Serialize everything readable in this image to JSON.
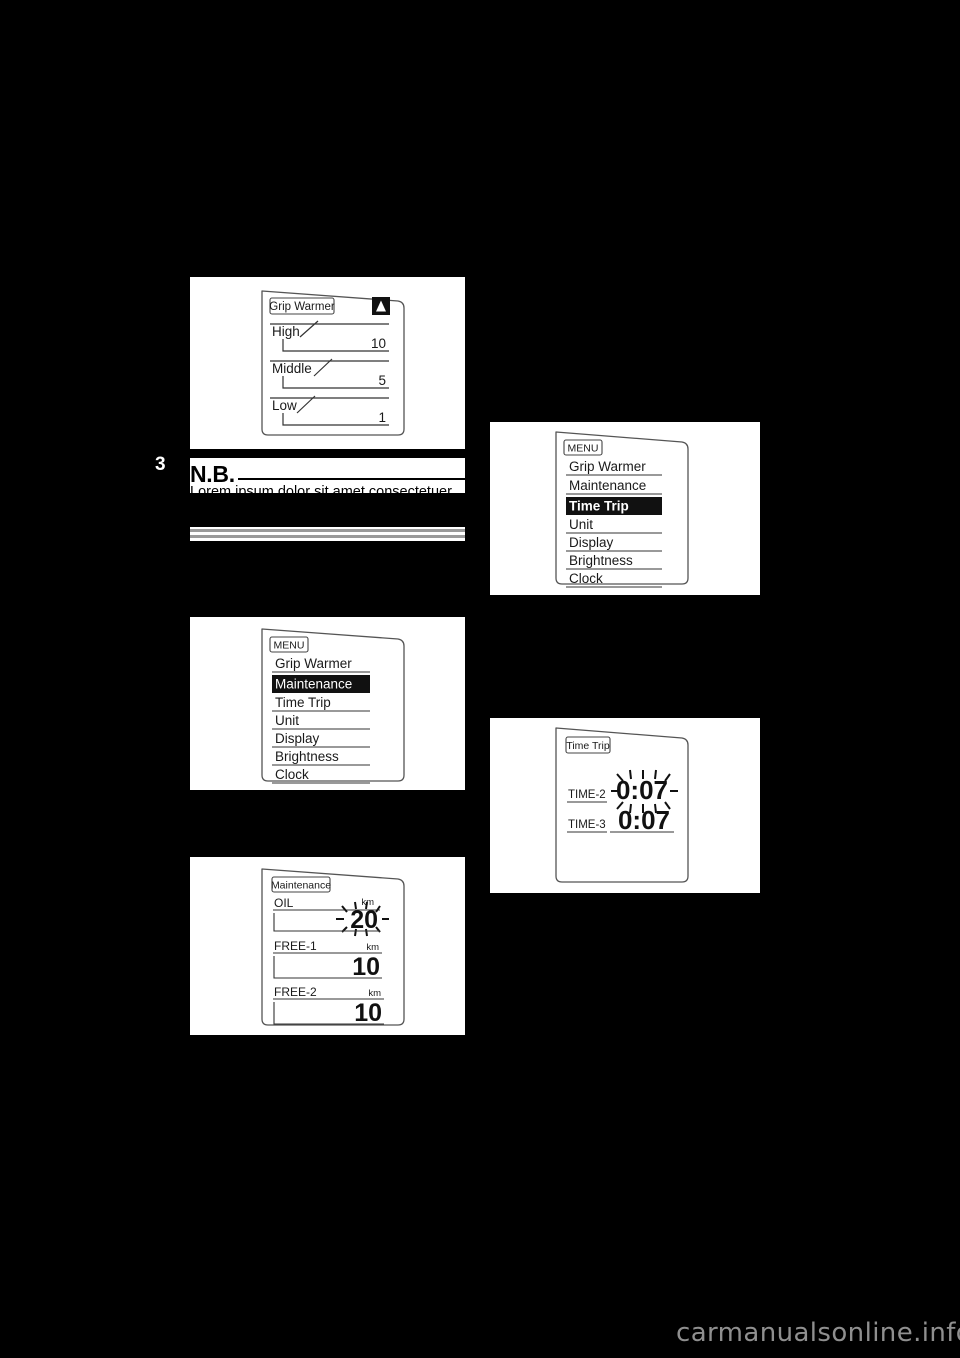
{
  "page": {
    "chapter_tab": "3",
    "background_color": "#000000",
    "panel_color": "#ffffff",
    "watermark": "carmanualsonline.info",
    "watermark_color": "#8f8f8f"
  },
  "note_block": {
    "heading": "N.B.",
    "clipped_line": "Lorem ipsum dolor sit amet consectetuer",
    "rule_color": "#000000",
    "double_rule_color": "#9a9a9a"
  },
  "figures": [
    {
      "id": "grip-warmer-screen",
      "title": "Grip Warmer",
      "indicator_icon": "grip-warmer-flame-icon",
      "rows": [
        {
          "label": "High",
          "value": "10"
        },
        {
          "label": "Middle",
          "value": "5"
        },
        {
          "label": "Low",
          "value": "1"
        }
      ]
    },
    {
      "id": "menu-screen-maintenance",
      "title": "MENU",
      "items": [
        {
          "label": "Grip Warmer",
          "selected": false
        },
        {
          "label": "Maintenance",
          "selected": true
        },
        {
          "label": "Time Trip",
          "selected": false
        },
        {
          "label": "Unit",
          "selected": false
        },
        {
          "label": "Display",
          "selected": false
        },
        {
          "label": "Brightness",
          "selected": false
        },
        {
          "label": "Clock",
          "selected": false
        }
      ]
    },
    {
      "id": "maintenance-screen",
      "title": "Maintenance",
      "rows": [
        {
          "label": "OIL",
          "unit": "km",
          "value": "20",
          "flashing": true
        },
        {
          "label": "FREE-1",
          "unit": "km",
          "value": "10",
          "flashing": false
        },
        {
          "label": "FREE-2",
          "unit": "km",
          "value": "10",
          "flashing": false
        }
      ]
    },
    {
      "id": "menu-screen-timetrip",
      "title": "MENU",
      "items": [
        {
          "label": "Grip Warmer",
          "selected": false
        },
        {
          "label": "Maintenance",
          "selected": false
        },
        {
          "label": "Time Trip",
          "selected": true
        },
        {
          "label": "Unit",
          "selected": false
        },
        {
          "label": "Display",
          "selected": false
        },
        {
          "label": "Brightness",
          "selected": false
        },
        {
          "label": "Clock",
          "selected": false
        }
      ]
    },
    {
      "id": "time-trip-screen",
      "title": "Time Trip",
      "rows": [
        {
          "label": "TIME-2",
          "value": "0:07",
          "flashing": true
        },
        {
          "label": "TIME-3",
          "value": "0:07",
          "flashing": false
        }
      ]
    }
  ]
}
